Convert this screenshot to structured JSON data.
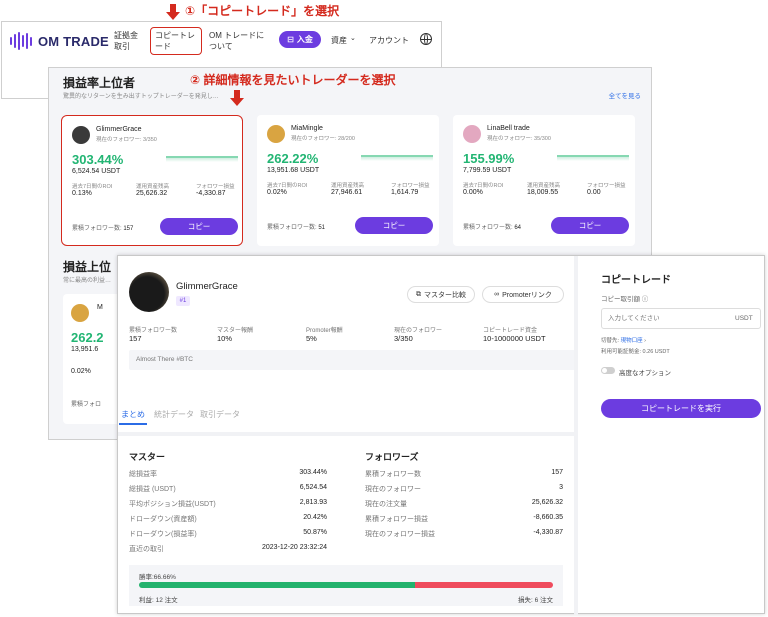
{
  "nav": {
    "logo_text": "OM TRADE",
    "items": [
      "証拠金取引",
      "コピートレード",
      "OM トレードについて",
      "資産",
      "アカウント"
    ],
    "deposit_label": "入金"
  },
  "annotations": {
    "step1": "①「コピートレード」を選択",
    "step2": "② 詳細情報を見たいトレーダーを選択"
  },
  "leaderboard": {
    "title": "損益率上位者",
    "subtitle": "驚異的なリターンを生み出すトップトレーダーを発見し…",
    "see_all": "全てを見る",
    "title2": "損益上位",
    "subtitle2": "常に最高の利益…",
    "stat_labels": [
      "過去7日間のROI",
      "運用資産残高",
      "フォロワー損益"
    ],
    "total_followers_label": "累積フォロワー数:",
    "copy_label": "コピー",
    "traders": [
      {
        "name": "GlimmerGrace",
        "followers": "現在のフォロワー: 3/350",
        "roi": "303.44%",
        "usdt": "6,524.54 USDT",
        "s1": "0.13%",
        "s2": "25,626.32",
        "s3": "-4,330.87",
        "total": "157",
        "avatar_color": "#3a3a3a"
      },
      {
        "name": "MiaMingle",
        "followers": "現在のフォロワー: 28/200",
        "roi": "262.22%",
        "usdt": "13,951.68 USDT",
        "s1": "0.02%",
        "s2": "27,946.61",
        "s3": "1,614.79",
        "total": "51",
        "avatar_color": "#d9a441"
      },
      {
        "name": "LinaBell trade",
        "followers": "現在のフォロワー: 35/300",
        "roi": "155.99%",
        "usdt": "7,799.59 USDT",
        "s1": "0.00%",
        "s2": "18,009.55",
        "s3": "0.00",
        "total": "64",
        "avatar_color": "#e3a8c0"
      }
    ],
    "partial": {
      "initial": "M",
      "roi": "262.2",
      "usdt": "13,951.6",
      "s1": "0.02%",
      "total_label": "累積フォロ"
    }
  },
  "detail": {
    "name": "GlimmerGrace",
    "rank": "#1",
    "master_compare_label": "マスター比較",
    "promoter_link_label": "Promoterリンク",
    "stats": [
      {
        "label": "累積フォロワー数",
        "value": "157"
      },
      {
        "label": "マスター報酬",
        "value": "10%"
      },
      {
        "label": "Promoter報酬",
        "value": "5%"
      },
      {
        "label": "現在のフォロワー",
        "value": "3/350"
      },
      {
        "label": "コピートレード資金",
        "value": "10-1000000 USDT"
      }
    ],
    "bio": "Almost There #BTC",
    "tabs": [
      "まとめ",
      "統計データ",
      "取引データ"
    ],
    "master": {
      "title": "マスター",
      "rows": [
        {
          "label": "総損益率",
          "value": "303.44%"
        },
        {
          "label": "総損益 (USDT)",
          "value": "6,524.54"
        },
        {
          "label": "平均ポジション損益(USDT)",
          "value": "2,813.93"
        },
        {
          "label": "ドローダウン(資産額)",
          "value": "20.42%"
        },
        {
          "label": "ドローダウン(損益率)",
          "value": "50.87%"
        },
        {
          "label": "直近の取引",
          "value": "2023-12-20 23:32:24"
        }
      ]
    },
    "followers": {
      "title": "フォロワーズ",
      "rows": [
        {
          "label": "累積フォロワー数",
          "value": "157"
        },
        {
          "label": "現在のフォロワー",
          "value": "3"
        },
        {
          "label": "現在の注文量",
          "value": "25,626.32"
        },
        {
          "label": "累積フォロワー損益",
          "value": "-8,660.35"
        },
        {
          "label": "現在のフォロワー損益",
          "value": "-4,330.87"
        }
      ]
    },
    "winrate": {
      "label": "勝率:66.66%",
      "fraction": 0.6666,
      "profit": "利益: 12 注文",
      "loss": "損失: 6 注文"
    },
    "copy_panel": {
      "title": "コピートレード",
      "amount_label": "コピー取引額 ⓘ",
      "amount_placeholder": "入力してください",
      "unit": "USDT",
      "account_prefix": "切替先:",
      "account_name": "現物口座",
      "balance": "利用可能証拠金: 0.26 USDT",
      "advanced_label": "高度なオプション",
      "execute_label": "コピートレードを実行"
    }
  },
  "colors": {
    "accent": "#6c3ce0",
    "annotation": "#d42a1e",
    "gain": "#22b573",
    "loss": "#ef4b5d",
    "link": "#2b6ce6"
  }
}
